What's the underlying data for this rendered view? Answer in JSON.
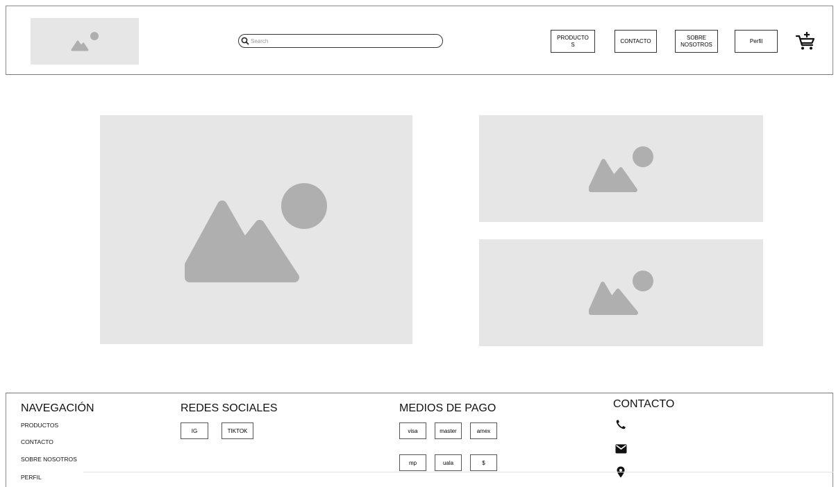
{
  "header": {
    "logo_icon": "image-placeholder-icon",
    "search": {
      "placeholder": "Search",
      "value": "",
      "icon": "search-icon"
    },
    "nav": [
      {
        "label": "PRODUCTO\nS"
      },
      {
        "label": "CONTACTO"
      },
      {
        "label": "SOBRE\nNOSOTROS"
      },
      {
        "label": "Perfil"
      }
    ],
    "cart_icon": "add-to-cart-icon"
  },
  "main": {
    "hero_icon": "image-placeholder-icon",
    "side_top_icon": "image-placeholder-icon",
    "side_bottom_icon": "image-placeholder-icon"
  },
  "footer": {
    "navegacion": {
      "title": "NAVEGACIÓN",
      "links": [
        "PRODUCTOS",
        "CONTACTO",
        "SOBRE NOSOTROS",
        "PERFIL"
      ]
    },
    "redes": {
      "title": "REDES SOCIALES",
      "buttons": [
        "IG",
        "TIKTOK"
      ]
    },
    "pagos": {
      "title": "MEDIOS DE PAGO",
      "buttons": [
        "visa",
        "master",
        "amex",
        "mp",
        "uala",
        "$"
      ]
    },
    "contacto": {
      "title": "CONTACTO",
      "icons": [
        "phone-icon",
        "mail-icon",
        "location-pin-icon"
      ]
    }
  },
  "colors": {
    "placeholder_bg": "#e6e6e6",
    "placeholder_shape": "#afafaf",
    "border": "#333333"
  }
}
